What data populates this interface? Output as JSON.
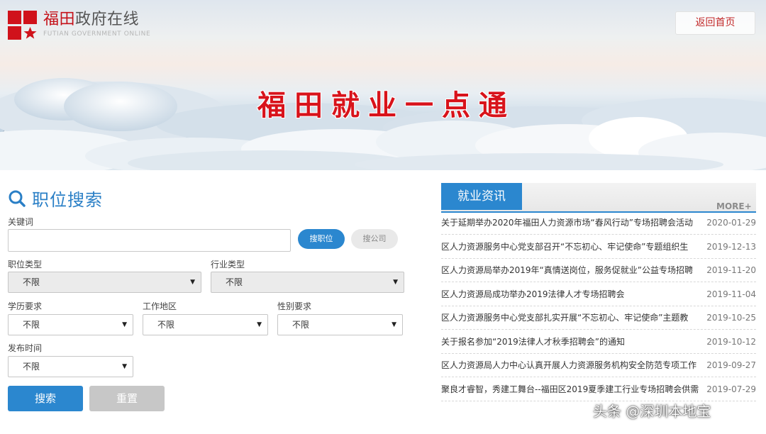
{
  "header": {
    "logo_cn_red": "福田",
    "logo_cn_gray": "政府在线",
    "logo_en": "FUTIAN GOVERNMENT ONLINE",
    "home_button": "返回首页",
    "banner_title": "福田就业一点通"
  },
  "search": {
    "title": "职位搜索",
    "keyword_label": "关键词",
    "keyword_value": "",
    "search_jobs_button": "搜职位",
    "search_company_button": "搜公司",
    "job_type_label": "职位类型",
    "job_type_value": "不限",
    "industry_label": "行业类型",
    "industry_value": "不限",
    "education_label": "学历要求",
    "education_value": "不限",
    "location_label": "工作地区",
    "location_value": "不限",
    "gender_label": "性别要求",
    "gender_value": "不限",
    "date_label": "发布时间",
    "date_value": "不限",
    "submit_button": "搜索",
    "reset_button": "重置"
  },
  "news": {
    "tab_label": "就业资讯",
    "more_label": "MORE+",
    "items": [
      {
        "title": "关于延期举办2020年福田人力资源市场“春风行动”专场招聘会活动",
        "date": "2020-01-29"
      },
      {
        "title": "区人力资源服务中心党支部召开“不忘初心、牢记使命”专题组织生",
        "date": "2019-12-13"
      },
      {
        "title": "区人力资源局举办2019年“真情送岗位，服务促就业”公益专场招聘",
        "date": "2019-11-20"
      },
      {
        "title": "区人力资源局成功举办2019法律人才专场招聘会",
        "date": "2019-11-04"
      },
      {
        "title": "区人力资源服务中心党支部扎实开展“不忘初心、牢记使命”主题教",
        "date": "2019-10-25"
      },
      {
        "title": "关于报名参加“2019法律人才秋季招聘会”的通知",
        "date": "2019-10-12"
      },
      {
        "title": "区人力资源局人力中心认真开展人力资源服务机构安全防范专项工作",
        "date": "2019-09-27"
      },
      {
        "title": "聚良才睿智，秀建工舞台--福田区2019夏季建工行业专场招聘会供需",
        "date": "2019-07-29"
      }
    ]
  },
  "watermark": "头条 @深圳本地宝",
  "colors": {
    "brand_red": "#d0121b",
    "accent_blue": "#2b87cf",
    "reset_gray": "#c7c7c7"
  }
}
